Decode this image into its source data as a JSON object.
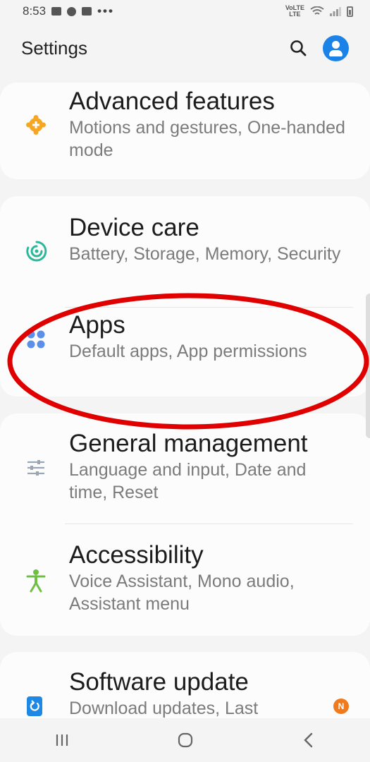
{
  "status_bar": {
    "time": "8:53",
    "overflow": "•••",
    "network_top": "VoLTE",
    "network_bottom": "LTE"
  },
  "header": {
    "title": "Settings"
  },
  "settings": [
    {
      "title": "Advanced features",
      "subtitle": "Motions and gestures, One-handed mode"
    },
    {
      "title": "Device care",
      "subtitle": "Battery, Storage, Memory, Security"
    },
    {
      "title": "Apps",
      "subtitle": "Default apps, App permissions"
    },
    {
      "title": "General management",
      "subtitle": "Language and input, Date and time, Reset"
    },
    {
      "title": "Accessibility",
      "subtitle": "Voice Assistant, Mono audio, Assistant menu"
    },
    {
      "title": "Software update",
      "subtitle": "Download updates, Last"
    }
  ],
  "badges": {
    "software_update": "N"
  },
  "icons": {
    "advanced_features": "gear-plus-icon",
    "device_care": "device-care-icon",
    "apps": "apps-grid-icon",
    "general_management": "sliders-icon",
    "accessibility": "accessibility-person-icon",
    "software_update": "software-update-icon",
    "search": "search-icon",
    "profile": "account-icon"
  },
  "colors": {
    "advanced_features_icon": "#f5a623",
    "device_care_icon": "#2bb89a",
    "apps_icon": "#5b8fe8",
    "general_management_icon": "#9aa7b3",
    "accessibility_icon": "#6fbf44",
    "software_update_icon": "#1e88e5",
    "highlight_ellipse": "#e00000",
    "accent": "#1b82e8"
  }
}
